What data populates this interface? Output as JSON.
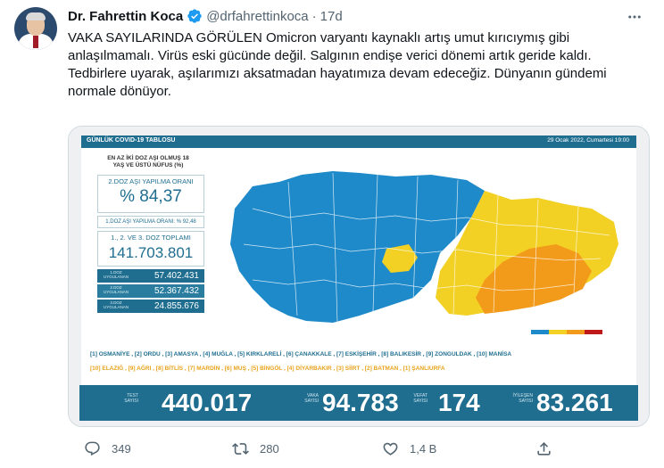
{
  "author": {
    "name": "Dr. Fahrettin Koca",
    "handle": "@drfahrettinkoca",
    "separator": "·",
    "time": "17d"
  },
  "tweet_text": "VAKA SAYILARINDA GÖRÜLEN Omicron varyantı kaynaklı artış umut kırıcıymış gibi anlaşılmamalı. Virüs eski gücünde değil. Salgının endişe verici dönemi artık geride kaldı. Tedbirlere uyarak, aşılarımızı aksatmadan hayatımıza devam edeceğiz. Dünyanın gündemi normale dönüyor.",
  "card": {
    "header_left": "GÜNLÜK COVID-19 TABLOSU",
    "header_right": "29 Ocak 2022, Cumartesi 19:00",
    "stats_title": "EN AZ İKİ DOZ AŞI OLMUŞ 18 YAŞ VE ÜSTÜ NÜFUS (%)",
    "dose2_rate_label": "2.DOZ AŞI YAPILMA ORANI",
    "dose2_rate": "% 84,37",
    "dose1_rate": "1.DOZ AŞI YAPILMA ORANI: % 92,48",
    "total_label": "1., 2. VE 3. DOZ TOPLAMI",
    "total_value": "141.703.801",
    "doses": [
      {
        "label": "1.DOZ UYGULANAN",
        "value": "57.402.431"
      },
      {
        "label": "2.DOZ UYGULANAN",
        "value": "52.367.432"
      },
      {
        "label": "3.DOZ UYGULANAN",
        "value": "24.855.676"
      }
    ],
    "legend": {
      "c1": "#1f8ac9",
      "c2": "#f2d024",
      "c3": "#f29a1a",
      "c4": "#c01818"
    },
    "lowest_row": "[1] OSMANİYE , [2] ORDU , [3] AMASYA , [4] MUĞLA , [5] KIRKLARELİ , [6] ÇANAKKALE , [7] ESKİŞEHİR , [8] BALIKESİR , [9] ZONGULDAK , [10] MANİSA",
    "highest_row": "[10] ELAZIĞ , [9] AĞRI , [8] BİTLİS , [7] MARDİN , [6] MUŞ , [5] BİNGÖL , [4] DİYARBAKIR , [3] SİİRT , [2] BATMAN , [1] ŞANLIURFA",
    "bottom": [
      {
        "label": "TEST SAYISI",
        "value": "440.017"
      },
      {
        "label": "VAKA SAYISI",
        "value": "94.783"
      },
      {
        "label": "VEFAT SAYISI",
        "value": "174"
      },
      {
        "label": "İYİLEŞEN SAYISI",
        "value": "83.261"
      }
    ]
  },
  "actions": {
    "replies": "349",
    "retweets": "280",
    "likes": "1,4 B"
  }
}
